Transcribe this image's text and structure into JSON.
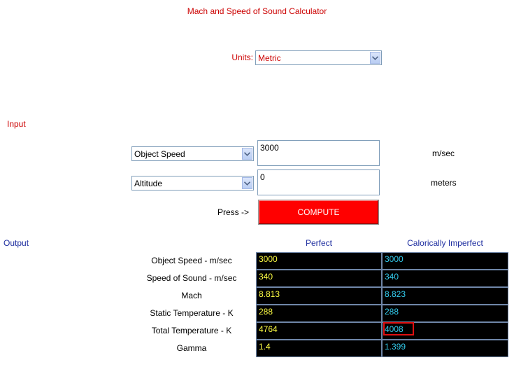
{
  "title": "Mach and Speed of Sound Calculator",
  "units": {
    "label": "Units:",
    "value": "Metric"
  },
  "input": {
    "section_label": "Input",
    "rows": [
      {
        "selector": "Object Speed",
        "value": "3000",
        "unit": "m/sec"
      },
      {
        "selector": "Altitude",
        "value": "0",
        "unit": "meters"
      }
    ],
    "press_label": "Press ->",
    "compute_label": "COMPUTE"
  },
  "output": {
    "section_label": "Output",
    "col_perfect": "Perfect",
    "col_imperfect": "Calorically Imperfect",
    "rows": [
      {
        "label": "Object Speed - m/sec",
        "perfect": "3000",
        "imperfect": "3000"
      },
      {
        "label": "Speed of Sound - m/sec",
        "perfect": "340",
        "imperfect": "340"
      },
      {
        "label": "Mach",
        "perfect": "8.813",
        "imperfect": "8.823"
      },
      {
        "label": "Static Temperature - K",
        "perfect": "288",
        "imperfect": "288"
      },
      {
        "label": "Total Temperature - K",
        "perfect": "4764",
        "imperfect": "4008"
      },
      {
        "label": "Gamma",
        "perfect": "1.4",
        "imperfect": "1.399"
      }
    ]
  },
  "colors": {
    "accent_red": "#cc0000",
    "compute_bg": "#ff0000",
    "output_blue": "#1f2fa0",
    "perfect_text": "#ffff44",
    "imperfect_text": "#33ccee"
  }
}
